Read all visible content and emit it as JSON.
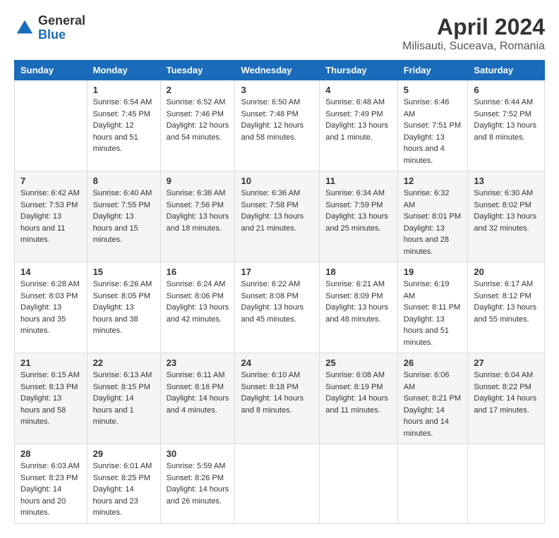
{
  "logo": {
    "general": "General",
    "blue": "Blue"
  },
  "header": {
    "title": "April 2024",
    "location": "Milisauti, Suceava, Romania"
  },
  "days_of_week": [
    "Sunday",
    "Monday",
    "Tuesday",
    "Wednesday",
    "Thursday",
    "Friday",
    "Saturday"
  ],
  "weeks": [
    [
      {
        "day": "",
        "sunrise": "",
        "sunset": "",
        "daylight": ""
      },
      {
        "day": "1",
        "sunrise": "Sunrise: 6:54 AM",
        "sunset": "Sunset: 7:45 PM",
        "daylight": "Daylight: 12 hours and 51 minutes."
      },
      {
        "day": "2",
        "sunrise": "Sunrise: 6:52 AM",
        "sunset": "Sunset: 7:46 PM",
        "daylight": "Daylight: 12 hours and 54 minutes."
      },
      {
        "day": "3",
        "sunrise": "Sunrise: 6:50 AM",
        "sunset": "Sunset: 7:48 PM",
        "daylight": "Daylight: 12 hours and 58 minutes."
      },
      {
        "day": "4",
        "sunrise": "Sunrise: 6:48 AM",
        "sunset": "Sunset: 7:49 PM",
        "daylight": "Daylight: 13 hours and 1 minute."
      },
      {
        "day": "5",
        "sunrise": "Sunrise: 6:46 AM",
        "sunset": "Sunset: 7:51 PM",
        "daylight": "Daylight: 13 hours and 4 minutes."
      },
      {
        "day": "6",
        "sunrise": "Sunrise: 6:44 AM",
        "sunset": "Sunset: 7:52 PM",
        "daylight": "Daylight: 13 hours and 8 minutes."
      }
    ],
    [
      {
        "day": "7",
        "sunrise": "Sunrise: 6:42 AM",
        "sunset": "Sunset: 7:53 PM",
        "daylight": "Daylight: 13 hours and 11 minutes."
      },
      {
        "day": "8",
        "sunrise": "Sunrise: 6:40 AM",
        "sunset": "Sunset: 7:55 PM",
        "daylight": "Daylight: 13 hours and 15 minutes."
      },
      {
        "day": "9",
        "sunrise": "Sunrise: 6:38 AM",
        "sunset": "Sunset: 7:56 PM",
        "daylight": "Daylight: 13 hours and 18 minutes."
      },
      {
        "day": "10",
        "sunrise": "Sunrise: 6:36 AM",
        "sunset": "Sunset: 7:58 PM",
        "daylight": "Daylight: 13 hours and 21 minutes."
      },
      {
        "day": "11",
        "sunrise": "Sunrise: 6:34 AM",
        "sunset": "Sunset: 7:59 PM",
        "daylight": "Daylight: 13 hours and 25 minutes."
      },
      {
        "day": "12",
        "sunrise": "Sunrise: 6:32 AM",
        "sunset": "Sunset: 8:01 PM",
        "daylight": "Daylight: 13 hours and 28 minutes."
      },
      {
        "day": "13",
        "sunrise": "Sunrise: 6:30 AM",
        "sunset": "Sunset: 8:02 PM",
        "daylight": "Daylight: 13 hours and 32 minutes."
      }
    ],
    [
      {
        "day": "14",
        "sunrise": "Sunrise: 6:28 AM",
        "sunset": "Sunset: 8:03 PM",
        "daylight": "Daylight: 13 hours and 35 minutes."
      },
      {
        "day": "15",
        "sunrise": "Sunrise: 6:26 AM",
        "sunset": "Sunset: 8:05 PM",
        "daylight": "Daylight: 13 hours and 38 minutes."
      },
      {
        "day": "16",
        "sunrise": "Sunrise: 6:24 AM",
        "sunset": "Sunset: 8:06 PM",
        "daylight": "Daylight: 13 hours and 42 minutes."
      },
      {
        "day": "17",
        "sunrise": "Sunrise: 6:22 AM",
        "sunset": "Sunset: 8:08 PM",
        "daylight": "Daylight: 13 hours and 45 minutes."
      },
      {
        "day": "18",
        "sunrise": "Sunrise: 6:21 AM",
        "sunset": "Sunset: 8:09 PM",
        "daylight": "Daylight: 13 hours and 48 minutes."
      },
      {
        "day": "19",
        "sunrise": "Sunrise: 6:19 AM",
        "sunset": "Sunset: 8:11 PM",
        "daylight": "Daylight: 13 hours and 51 minutes."
      },
      {
        "day": "20",
        "sunrise": "Sunrise: 6:17 AM",
        "sunset": "Sunset: 8:12 PM",
        "daylight": "Daylight: 13 hours and 55 minutes."
      }
    ],
    [
      {
        "day": "21",
        "sunrise": "Sunrise: 6:15 AM",
        "sunset": "Sunset: 8:13 PM",
        "daylight": "Daylight: 13 hours and 58 minutes."
      },
      {
        "day": "22",
        "sunrise": "Sunrise: 6:13 AM",
        "sunset": "Sunset: 8:15 PM",
        "daylight": "Daylight: 14 hours and 1 minute."
      },
      {
        "day": "23",
        "sunrise": "Sunrise: 6:11 AM",
        "sunset": "Sunset: 8:16 PM",
        "daylight": "Daylight: 14 hours and 4 minutes."
      },
      {
        "day": "24",
        "sunrise": "Sunrise: 6:10 AM",
        "sunset": "Sunset: 8:18 PM",
        "daylight": "Daylight: 14 hours and 8 minutes."
      },
      {
        "day": "25",
        "sunrise": "Sunrise: 6:08 AM",
        "sunset": "Sunset: 8:19 PM",
        "daylight": "Daylight: 14 hours and 11 minutes."
      },
      {
        "day": "26",
        "sunrise": "Sunrise: 6:06 AM",
        "sunset": "Sunset: 8:21 PM",
        "daylight": "Daylight: 14 hours and 14 minutes."
      },
      {
        "day": "27",
        "sunrise": "Sunrise: 6:04 AM",
        "sunset": "Sunset: 8:22 PM",
        "daylight": "Daylight: 14 hours and 17 minutes."
      }
    ],
    [
      {
        "day": "28",
        "sunrise": "Sunrise: 6:03 AM",
        "sunset": "Sunset: 8:23 PM",
        "daylight": "Daylight: 14 hours and 20 minutes."
      },
      {
        "day": "29",
        "sunrise": "Sunrise: 6:01 AM",
        "sunset": "Sunset: 8:25 PM",
        "daylight": "Daylight: 14 hours and 23 minutes."
      },
      {
        "day": "30",
        "sunrise": "Sunrise: 5:59 AM",
        "sunset": "Sunset: 8:26 PM",
        "daylight": "Daylight: 14 hours and 26 minutes."
      },
      {
        "day": "",
        "sunrise": "",
        "sunset": "",
        "daylight": ""
      },
      {
        "day": "",
        "sunrise": "",
        "sunset": "",
        "daylight": ""
      },
      {
        "day": "",
        "sunrise": "",
        "sunset": "",
        "daylight": ""
      },
      {
        "day": "",
        "sunrise": "",
        "sunset": "",
        "daylight": ""
      }
    ]
  ]
}
